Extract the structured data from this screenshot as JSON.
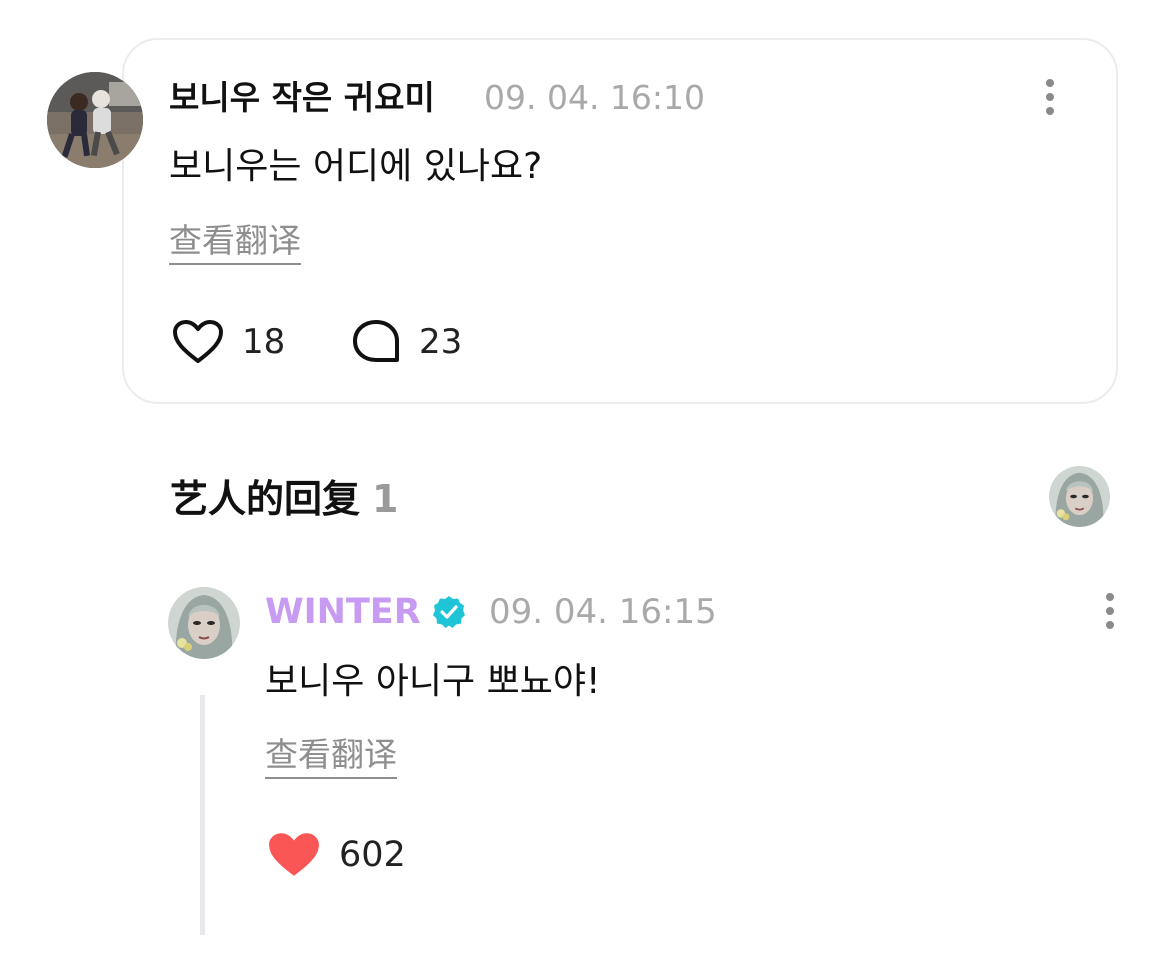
{
  "post": {
    "author": "보니우 작은 귀요미",
    "time": "09. 04. 16:10",
    "text": "보니우는 어디에 있나요?",
    "translate_label": "查看翻译",
    "likes": "18",
    "comments": "23"
  },
  "artist_replies": {
    "heading": "艺人的回复",
    "count": "1"
  },
  "reply": {
    "author": "WINTER",
    "time": "09. 04. 16:15",
    "text": "보니우 아니구 뽀뇨야!",
    "translate_label": "查看翻译",
    "likes": "602"
  },
  "colors": {
    "artist_name": "#c79bf2",
    "verified_badge": "#1fc4d6",
    "liked_heart": "#fb5656",
    "muted_text": "#a9a9a9",
    "card_border": "#ececec"
  },
  "icons": {
    "more": "more-vertical-icon",
    "like": "heart-outline-icon",
    "comment": "speech-bubble-icon",
    "liked": "heart-filled-icon",
    "verified": "verified-badge-icon"
  }
}
